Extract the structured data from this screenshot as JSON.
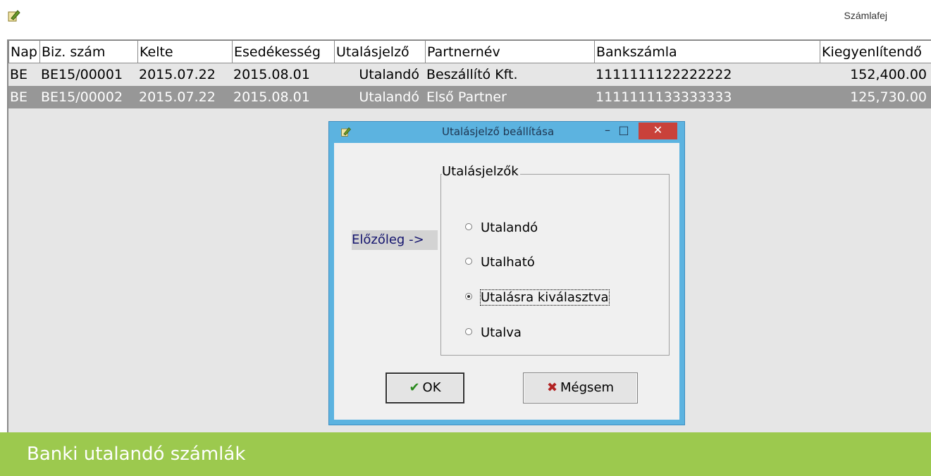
{
  "window": {
    "title": "Számlafej"
  },
  "table": {
    "columns": [
      "Nap",
      "Biz. szám",
      "Kelte",
      "Esedékesség",
      "Utalásjelző",
      "Partnernév",
      "Bankszámla",
      "Kiegyenlítendő"
    ],
    "rows": [
      [
        "BE",
        "BE15/00001",
        "2015.07.22",
        "2015.08.01",
        "Utalandó",
        "Beszállító Kft.",
        "1111111122222222",
        "152,400.00"
      ],
      [
        "BE",
        "BE15/00002",
        "2015.07.22",
        "2015.08.01",
        "Utalandó",
        "Első Partner",
        "1111111133333333",
        "125,730.00"
      ]
    ]
  },
  "dialog": {
    "title": "Utalásjelző beállítása",
    "previous_label": "Előzőleg ->",
    "group_title": "Utalásjelzők",
    "options": [
      "Utalandó",
      "Utalható",
      "Utalásra kiválasztva",
      "Utalva"
    ],
    "selected_option": "Utalásra kiválasztva",
    "ok_label": "OK",
    "cancel_label": "Mégsem"
  },
  "footer": {
    "caption": "Banki utalandó számlák"
  },
  "colors": {
    "footer_bg": "#9cc94e",
    "dialog_frame": "#5cb3e0",
    "selected_row": "#979797",
    "close_button": "#c9413a"
  },
  "icons": {
    "app": "edit-note-icon"
  }
}
